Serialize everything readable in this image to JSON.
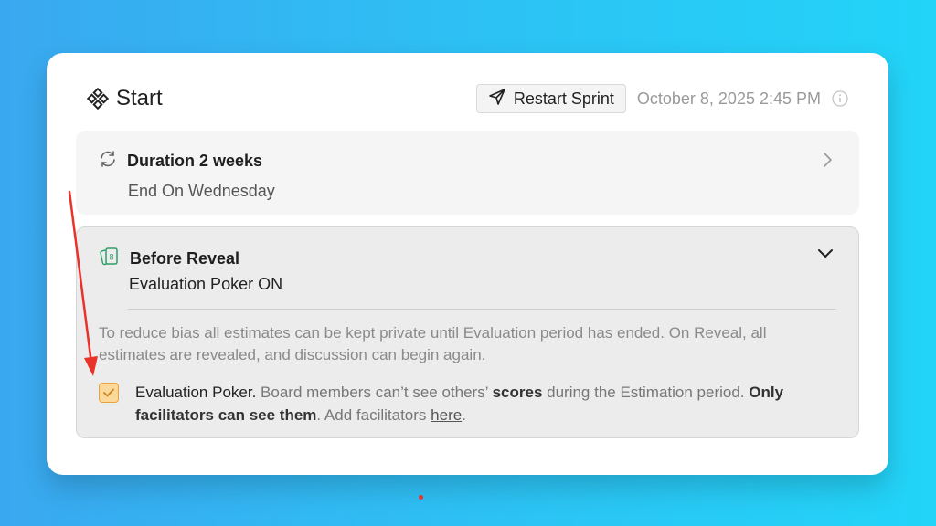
{
  "header": {
    "title": "Start",
    "title_icon": "sprint-start-icon",
    "restart_label": "Restart Sprint",
    "restart_icon": "paper-plane-icon",
    "datetime": "October 8, 2025 2:45 PM",
    "info_icon": "info-icon"
  },
  "duration": {
    "icon": "refresh-cycle-icon",
    "title": "Duration 2 weeks",
    "subtitle": "End On Wednesday",
    "chevron": "chevron-right-icon"
  },
  "before_reveal": {
    "icon": "cards-icon",
    "card_number": "8",
    "title": "Before Reveal",
    "subtitle": "Evaluation Poker ON",
    "chevron": "chevron-down-icon",
    "description": "To reduce bias all estimates can be kept private until Evaluation period has ended. On Reveal, all estimates are revealed, and discussion can begin again.",
    "checkbox_checked": true,
    "option": {
      "lead": "Evaluation Poker.",
      "text_1": " Board members can’t see others’ ",
      "bold_1": "scores",
      "text_2": " during the Estimation period. ",
      "bold_2": "Only facilitators can see them",
      "text_3": ". Add facilitators ",
      "link": "here",
      "text_4": "."
    }
  },
  "colors": {
    "background_start": "#3aa8f0",
    "background_end": "#22d4f8",
    "checkbox_fill": "#fbd99a",
    "checkbox_border": "#e8a43c",
    "annotation_arrow": "#e8322a"
  }
}
